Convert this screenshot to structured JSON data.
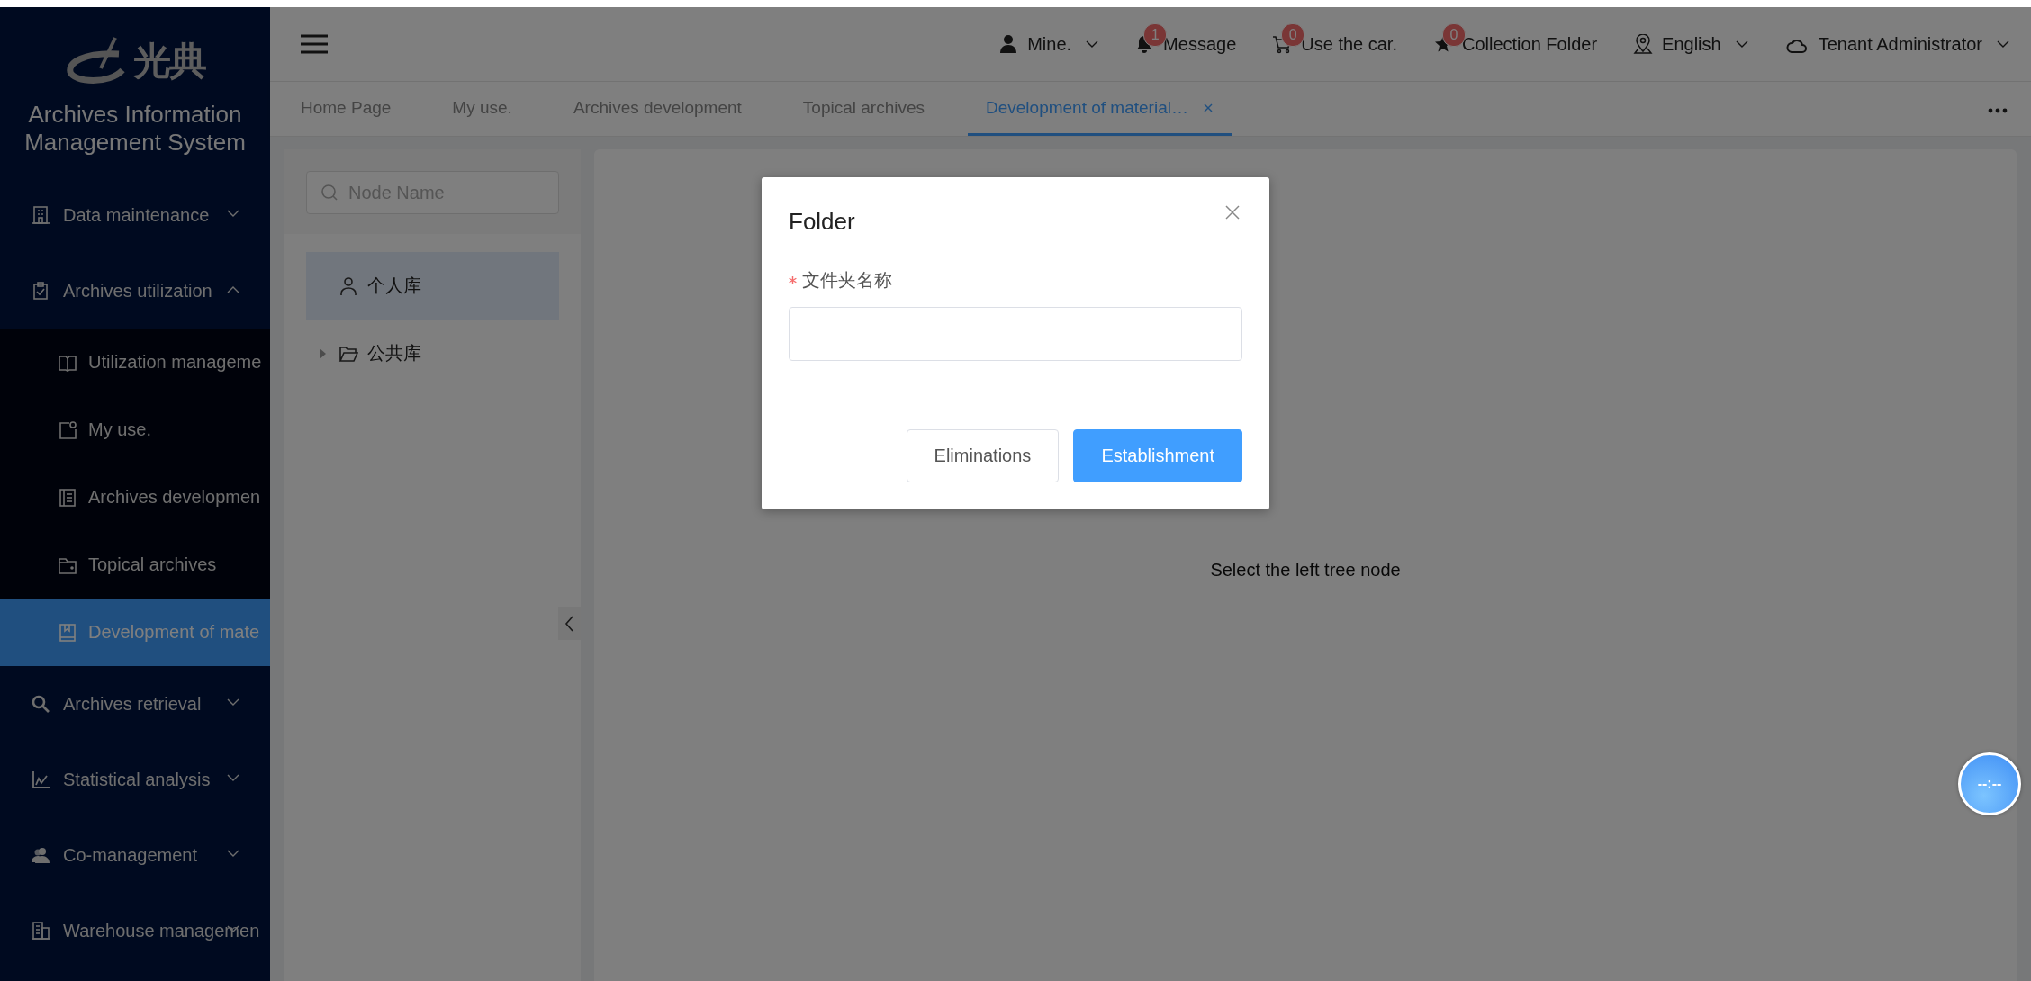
{
  "sidebar": {
    "logo_text": "光典",
    "title": "Archives Information Management System",
    "menu": [
      {
        "label": "Data maintenance",
        "expanded": false
      },
      {
        "label": "Archives utilization",
        "expanded": true,
        "children": [
          {
            "label": "Utilization manageme",
            "selected": false
          },
          {
            "label": "My use.",
            "selected": false
          },
          {
            "label": "Archives developmen",
            "selected": false
          },
          {
            "label": "Topical archives",
            "selected": false
          },
          {
            "label": "Development of mate",
            "selected": true
          }
        ]
      },
      {
        "label": "Archives retrieval",
        "expanded": false
      },
      {
        "label": "Statistical analysis",
        "expanded": false
      },
      {
        "label": "Co-management",
        "expanded": false
      },
      {
        "label": "Warehouse managemen",
        "expanded": false
      }
    ]
  },
  "header": {
    "user": "Mine.",
    "items": [
      {
        "label": "Message",
        "badge": "1"
      },
      {
        "label": "Use the car.",
        "badge": "0"
      },
      {
        "label": "Collection Folder",
        "badge": "0"
      }
    ],
    "language": "English",
    "account": "Tenant Administrator"
  },
  "tabs": [
    {
      "label": "Home Page",
      "selected": false
    },
    {
      "label": "My use.",
      "selected": false
    },
    {
      "label": "Archives development",
      "selected": false
    },
    {
      "label": "Topical archives",
      "selected": false
    },
    {
      "label": "Development of material…",
      "selected": true
    }
  ],
  "tree": {
    "search": {
      "placeholder": "Node Name"
    },
    "nodes": [
      {
        "label": "个人库",
        "selected": true,
        "kind": "person"
      },
      {
        "label": "公共库",
        "selected": false,
        "kind": "folder",
        "expanded": false
      }
    ]
  },
  "content": {
    "empty_text": "Select the left tree node"
  },
  "dialog": {
    "title": "Folder",
    "field": {
      "label": "文件夹名称",
      "required": true
    },
    "buttons": [
      {
        "label": "Eliminations",
        "kind": "default"
      },
      {
        "label": "Establishment",
        "kind": "primary"
      }
    ]
  },
  "clock": {
    "text": "--:--"
  }
}
